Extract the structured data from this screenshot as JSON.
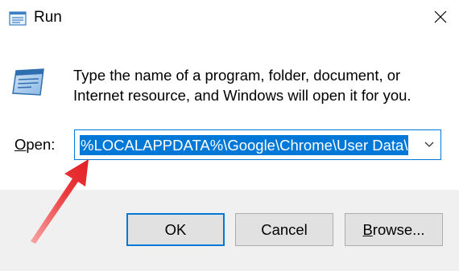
{
  "window": {
    "title": "Run",
    "close_icon": "close-icon"
  },
  "description": {
    "line1": "Type the name of a program, folder, document, or",
    "line2": "Internet resource, and Windows will open it for you."
  },
  "open_field": {
    "label_prefix": "",
    "label_accel": "O",
    "label_rest": "pen:",
    "value": "%LOCALAPPDATA%\\Google\\Chrome\\User Data\\"
  },
  "buttons": {
    "ok": "OK",
    "cancel": "Cancel",
    "browse_accel": "B",
    "browse_rest": "rowse..."
  },
  "colors": {
    "accent": "#0078d7",
    "annotation_arrow": "#e8262a"
  }
}
